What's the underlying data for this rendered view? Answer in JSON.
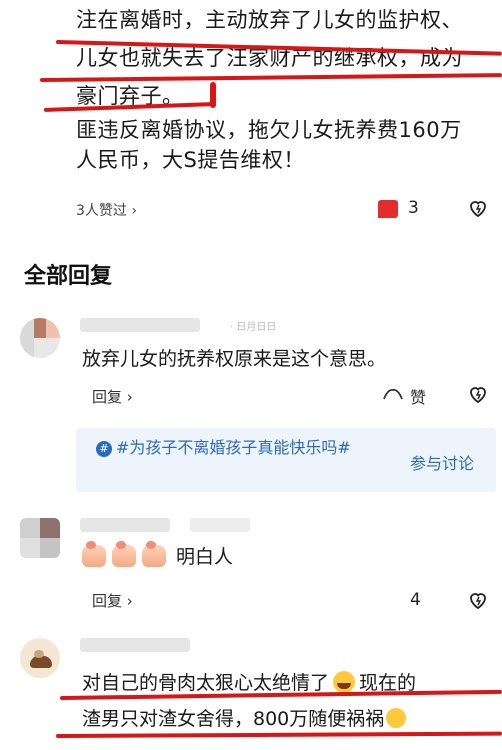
{
  "post": {
    "line1": "注在离婚时，主动放弃了儿女的监护权、",
    "line2": "儿女也就失去了汪家财产的继承权，成为",
    "line3": "豪门弃子。",
    "line4": "匪违反离婚协议，拖欠儿女抚养费160万",
    "line5": "人民币，大S提告维权！",
    "likes_text": "3人赞过 ›",
    "like_count": "3"
  },
  "section_title": "全部回复",
  "comments": [
    {
      "name_hint": "· 日月日日",
      "text": "放弃儿女的抚养权原来是这个意思。",
      "reply_label": "回复 ›",
      "like_label": "赞"
    },
    {
      "text": "明白人",
      "reply_label": "回复 ›",
      "count": "4"
    },
    {
      "line1": "对自己的骨肉太狠心太绝情了",
      "line1b": "现在的",
      "line2": "渣男只对渣女舍得，800万随便祸祸"
    }
  ],
  "topic": {
    "text": "#为孩子不离婚孩子真能快乐吗#",
    "join_label": "参与讨论"
  },
  "colors": {
    "annotation_red": "#d81616",
    "topic_blue": "#2b6cb8",
    "topic_bg": "#eef4fb"
  },
  "icons": [
    "hash-badge-icon",
    "heart-icon",
    "like-icon",
    "clap-emoji-icon",
    "laugh-cry-emoji-icon"
  ]
}
